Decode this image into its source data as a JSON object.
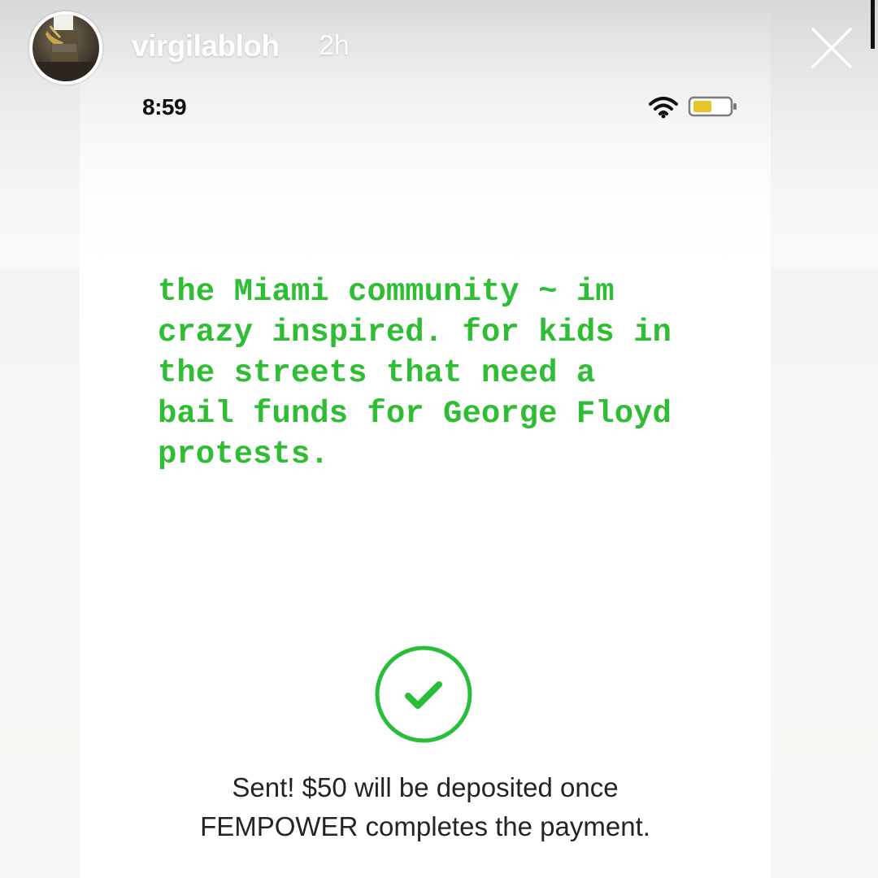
{
  "story_header": {
    "username": "virgilabloh",
    "time_ago": "2h",
    "avatar_icon": "profile-photo",
    "close_icon": "close-x"
  },
  "status_bar": {
    "time": "8:59",
    "wifi_icon": "wifi",
    "battery_icon": "battery-low"
  },
  "note": {
    "text": "the Miami community ~ im\ncrazy inspired. for kids in\nthe streets that need a\nbail funds for George Floyd\nprotests."
  },
  "payment_status": {
    "icon": "check-circle",
    "line1": "Sent! $50 will be deposited once",
    "line2": "FEMPOWER completes the payment."
  },
  "colors": {
    "note_text": "#2ebd33",
    "success_green": "#29be39",
    "status_text": "#242424",
    "battery_fill": "#e8c52d"
  }
}
